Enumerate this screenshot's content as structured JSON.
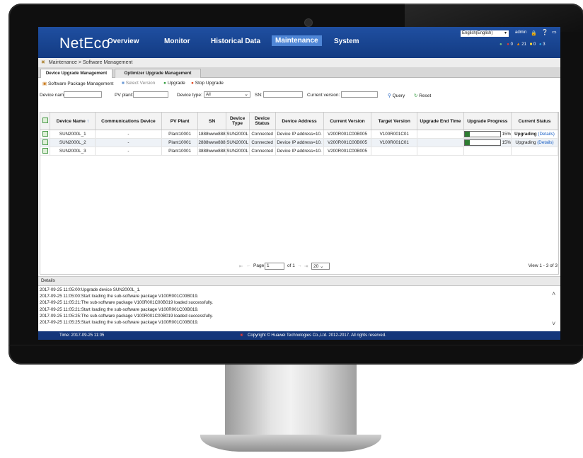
{
  "nav": {
    "logo": "NetEco",
    "items": [
      "Overview",
      "Monitor",
      "Historical Data",
      "Maintenance",
      "System"
    ],
    "active": "Maintenance"
  },
  "topright": {
    "language": "English(English)",
    "user": "admin",
    "alarms": [
      {
        "count": "0",
        "color": "#e53935"
      },
      {
        "count": "21",
        "color": "#fb8c00"
      },
      {
        "count": "0",
        "color": "#fdd835"
      },
      {
        "count": "3",
        "color": "#29b6f6"
      }
    ]
  },
  "breadcrumb": "Maintenance > Software Management",
  "tabs": [
    "Device Upgrade Management",
    "Optimizer Upgrade Management"
  ],
  "toolbar": {
    "package_mgmt": "Software Package Management",
    "select_version": "Select Version",
    "upgrade": "Upgrade",
    "stop_upgrade": "Stop Upgrade"
  },
  "filters": {
    "device_name": "Device name:",
    "pv_plant": "PV plant:",
    "device_type": "Device type:",
    "device_type_value": "All",
    "sn": "SN:",
    "current_version": "Current version:",
    "query": "Query",
    "reset": "Reset"
  },
  "table": {
    "headers": [
      "Device Name",
      "Communications Device",
      "PV Plant",
      "SN",
      "Device Type",
      "Device Status",
      "Device Address",
      "Current Version",
      "Target Version",
      "Upgrade End Time",
      "Upgrade Progress",
      "Current Status"
    ],
    "sort_indicator": "↑",
    "rows": [
      {
        "name": "SUN2000L_1",
        "comm": "-",
        "plant": "Plant10001",
        "sn": "1888www888",
        "type": "SUN2000L",
        "status": "Connected",
        "address": "Device IP address=10.",
        "current": "V200R001C00B005",
        "target": "V100R001C01",
        "end": "",
        "progress": "15%",
        "progress_value": 0.15,
        "cur_status": "Upgrading",
        "details": "(Details)"
      },
      {
        "name": "SUN2000L_2",
        "comm": "-",
        "plant": "Plant10001",
        "sn": "2888www888",
        "type": "SUN2000L",
        "status": "Connected",
        "address": "Device IP address=10.",
        "current": "V200R001C00B005",
        "target": "V100R001C01",
        "end": "",
        "progress": "15%",
        "progress_value": 0.15,
        "cur_status": "Upgrading",
        "details": "(Details)"
      },
      {
        "name": "SUN2000L_3",
        "comm": "-",
        "plant": "Plant10001",
        "sn": "3888www888",
        "type": "SUN2000L",
        "status": "Connected",
        "address": "Device IP address=10.",
        "current": "V200R001C00B005",
        "target": "",
        "end": "",
        "progress": "",
        "progress_value": null,
        "cur_status": "",
        "details": ""
      }
    ]
  },
  "pager": {
    "page_label": "Page",
    "page": "1",
    "of": "of 1",
    "page_size": "20",
    "view": "View 1 - 3 of 3"
  },
  "details": {
    "title": "Details",
    "lines": [
      "2017-09-25 11:05:00:Upgrade device SUN2000L_1.",
      "2017-09-25 11:05:00:Start loading the sub-software package V100R001C00B019.",
      "2017-09-25 11:05:21:The sub-software package V100R001C00B019 loaded successfully.",
      "2017-09-25 11:05:21:Start loading the sub-software package V100R001C00B019.",
      "2017-09-25 11:05:25:The sub-software package V100R001C00B019 loaded successfully.",
      "2017-09-25 11:05:25:Start loading the sub-software package V100R001C00B019."
    ]
  },
  "footer": {
    "time": "Time:  2017-09-25 11:05",
    "copyright": "Copyright © Huawei Technologies Co.,Ltd. 2012-2017. All rights reserved."
  }
}
